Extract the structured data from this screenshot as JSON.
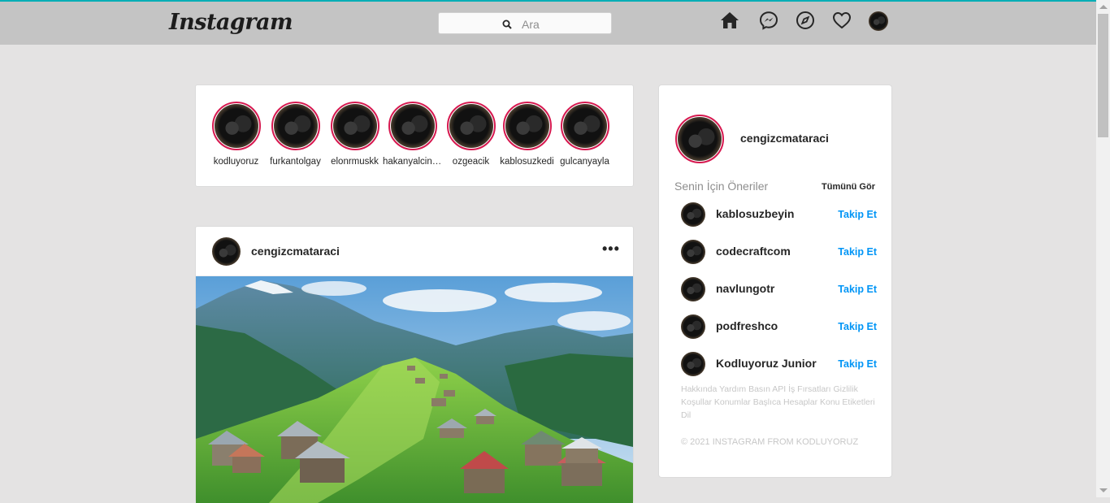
{
  "nav": {
    "logo": "Instagram",
    "search_placeholder": "Ara",
    "icons": [
      "home-icon",
      "messenger-icon",
      "explore-icon",
      "heart-icon",
      "profile-avatar"
    ]
  },
  "stories": [
    {
      "username": "kodluyoruz"
    },
    {
      "username": "furkantolgay"
    },
    {
      "username": "elonrmuskk"
    },
    {
      "username": "hakanyalcinkaya"
    },
    {
      "username": "ozgeacik"
    },
    {
      "username": "kablosuzkedi"
    },
    {
      "username": "gulcanyayla"
    }
  ],
  "post": {
    "username": "cengizcmataraci",
    "more": "•••"
  },
  "sidebar": {
    "username": "cengizcmataraci",
    "suggestions_title": "Senin İçin Öneriler",
    "see_all": "Tümünü Gör",
    "follow_label": "Takip Et",
    "suggestions": [
      {
        "username": "kablosuzbeyin"
      },
      {
        "username": "codecraftcom"
      },
      {
        "username": "navlungotr"
      },
      {
        "username": "podfreshco"
      },
      {
        "username": "Kodluyoruz Junior"
      }
    ],
    "footer_links": "Hakkında Yardım Basın API İş Fırsatları Gizlilik Koşullar Konumlar Başlıca Hesaplar Konu Etiketleri Dil",
    "copyright": "© 2021 INSTAGRAM FROM KODLUYORUZ"
  },
  "colors": {
    "accent_blue": "#0095f6",
    "story_ring": "#d6184f",
    "nav_bg": "#c4c4c4",
    "page_bg": "#e4e3e3"
  }
}
